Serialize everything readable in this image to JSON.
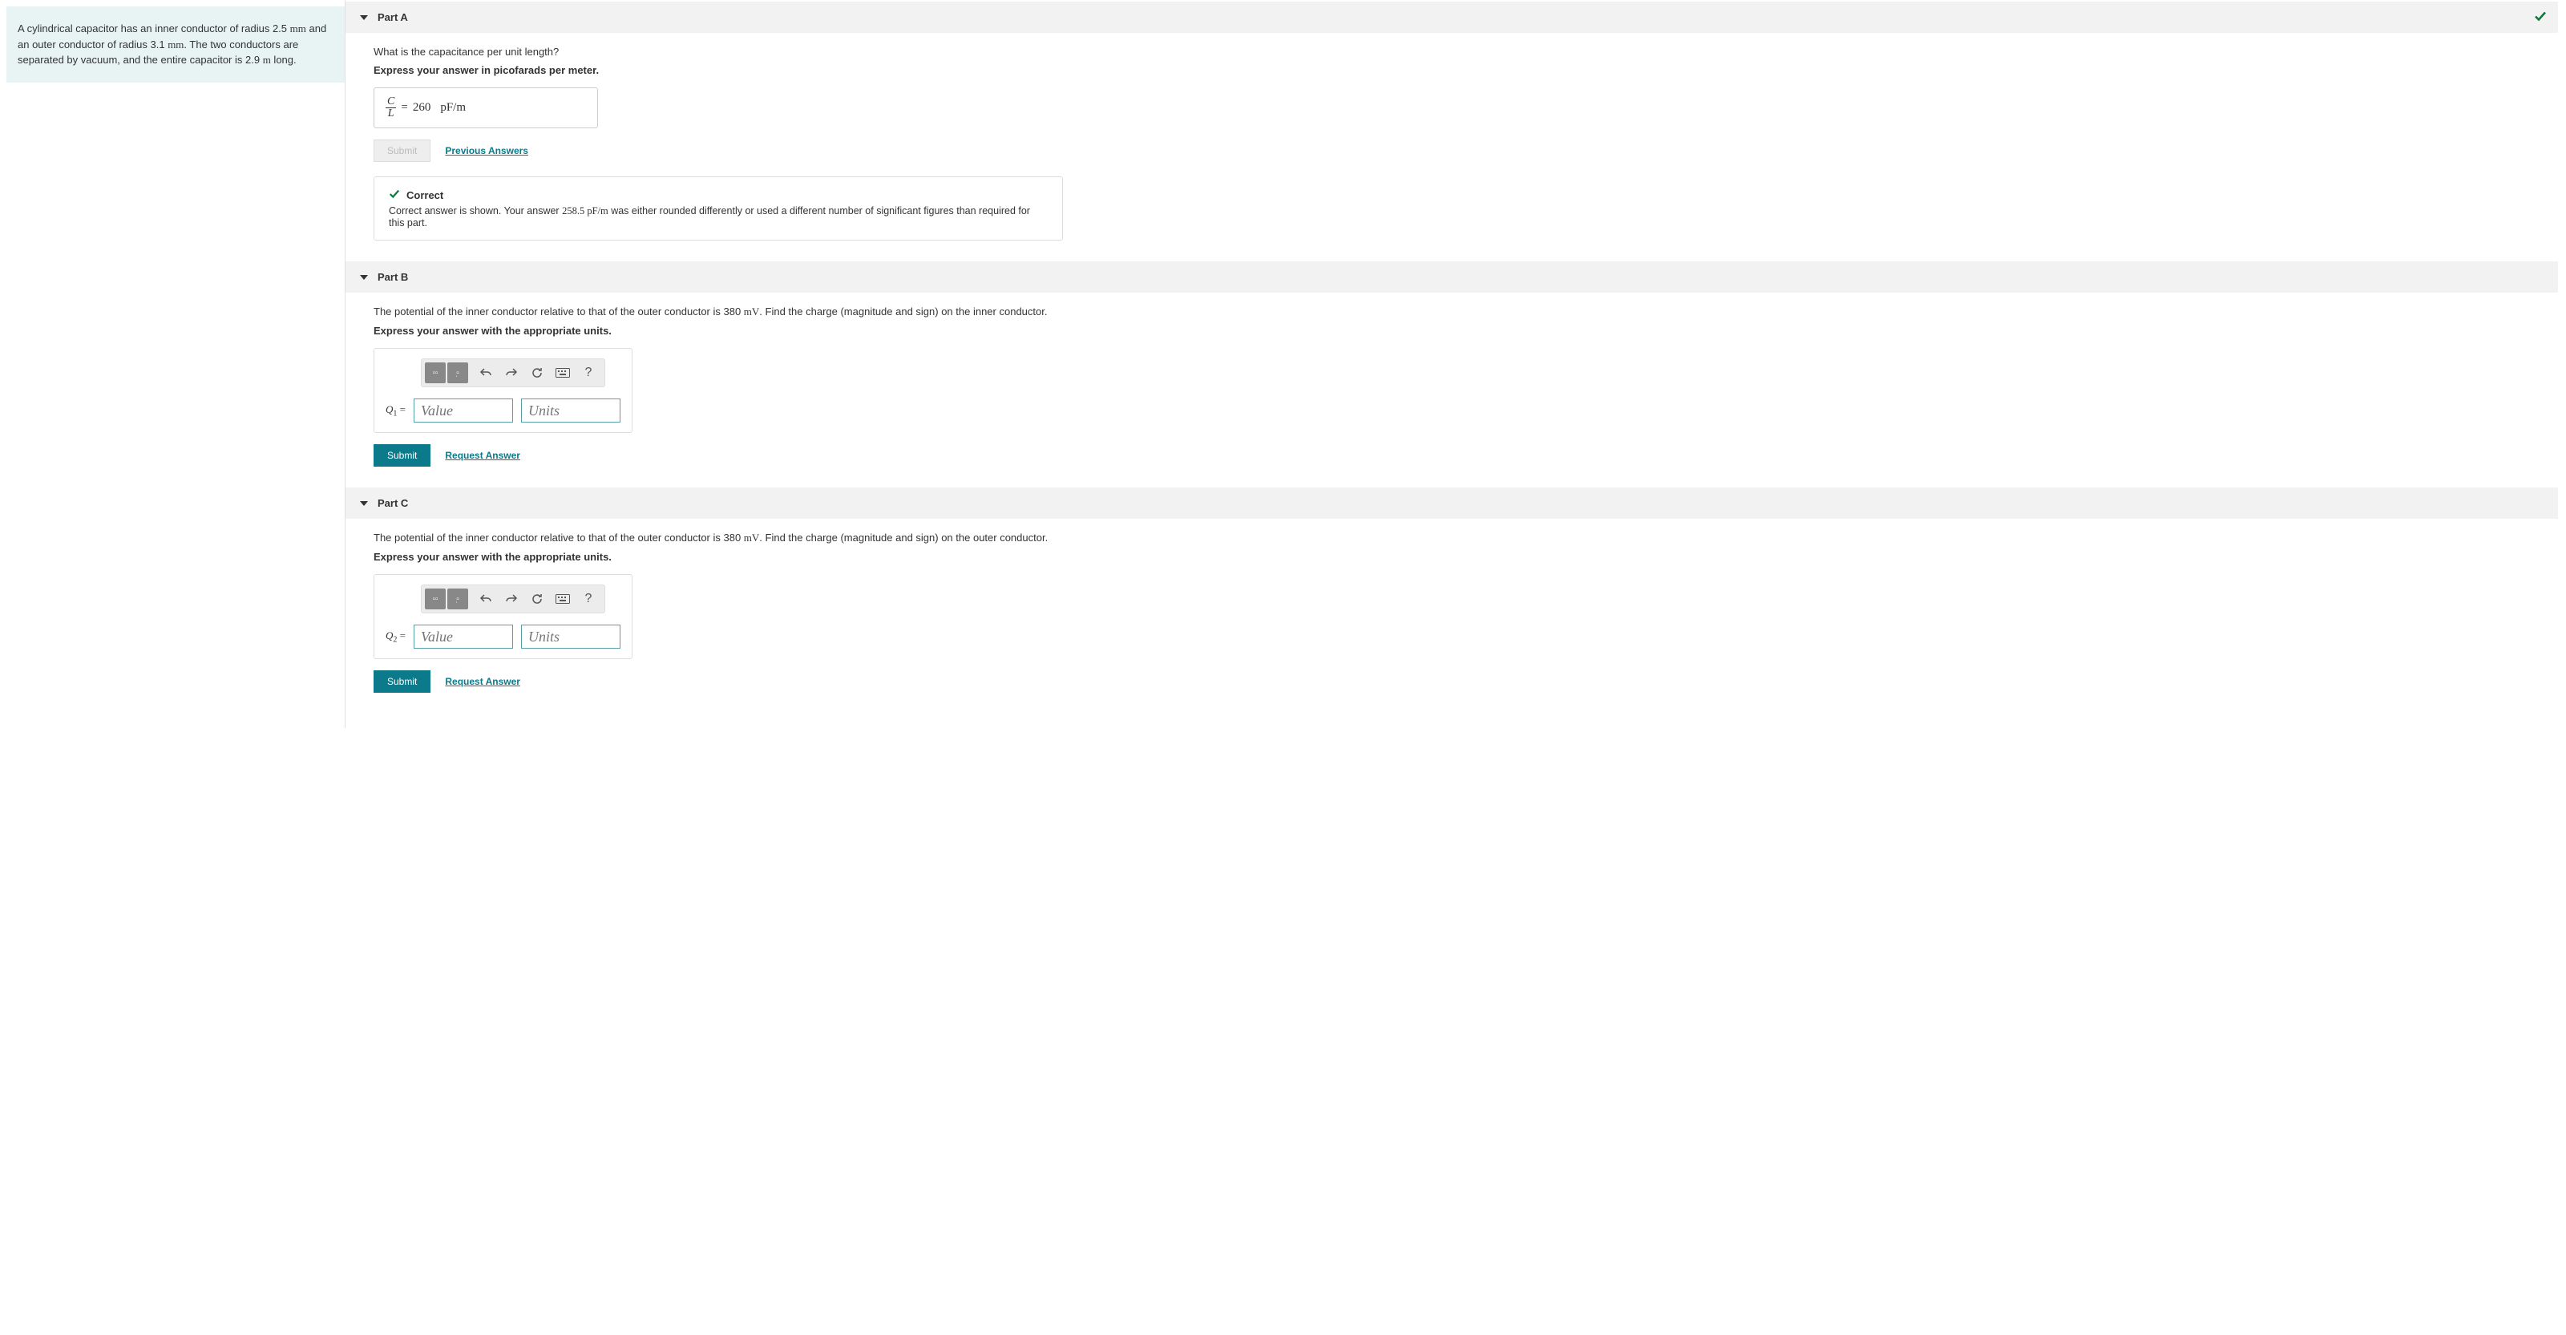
{
  "problem": {
    "text_before_r1": "A cylindrical capacitor has an inner conductor of radius 2.5 ",
    "unit_r1": "mm",
    "text_mid1": " and an outer conductor of radius 3.1 ",
    "unit_r2": "mm",
    "text_mid2": ". The two conductors are separated by vacuum, and the entire capacitor is 2.9 ",
    "unit_len": "m",
    "text_end": " long."
  },
  "partA": {
    "title": "Part A",
    "question": "What is the capacitance per unit length?",
    "instruction": "Express your answer in picofarads per meter.",
    "frac_num": "C",
    "frac_den": "L",
    "equals": "=",
    "value": "260",
    "unit_space": " ",
    "unit_p": "pF/m",
    "submit": "Submit",
    "prev": "Previous Answers",
    "fb_title": "Correct",
    "fb_pre": "Correct answer is shown. Your answer ",
    "fb_val": "258.5",
    "fb_unit": " pF/m",
    "fb_post": " was either rounded differently or used a different number of significant figures than required for this part."
  },
  "partB": {
    "title": "Part B",
    "q_pre": "The potential of the inner conductor relative to that of the outer conductor is 380 ",
    "q_unit": "mV",
    "q_post": ". Find the charge (magnitude and sign) on the inner conductor.",
    "instruction": "Express your answer with the appropriate units.",
    "var": "Q",
    "sub": "1",
    "eq": " = ",
    "value_ph": "Value",
    "units_ph": "Units",
    "submit": "Submit",
    "request": "Request Answer"
  },
  "partC": {
    "title": "Part C",
    "q_pre": "The potential of the inner conductor relative to that of the outer conductor is 380 ",
    "q_unit": "mV",
    "q_post": ". Find the charge (magnitude and sign) on the outer conductor.",
    "instruction": "Express your answer with the appropriate units.",
    "var": "Q",
    "sub": "2",
    "eq": " = ",
    "value_ph": "Value",
    "units_ph": "Units",
    "submit": "Submit",
    "request": "Request Answer"
  },
  "tb": {
    "help": "?"
  }
}
